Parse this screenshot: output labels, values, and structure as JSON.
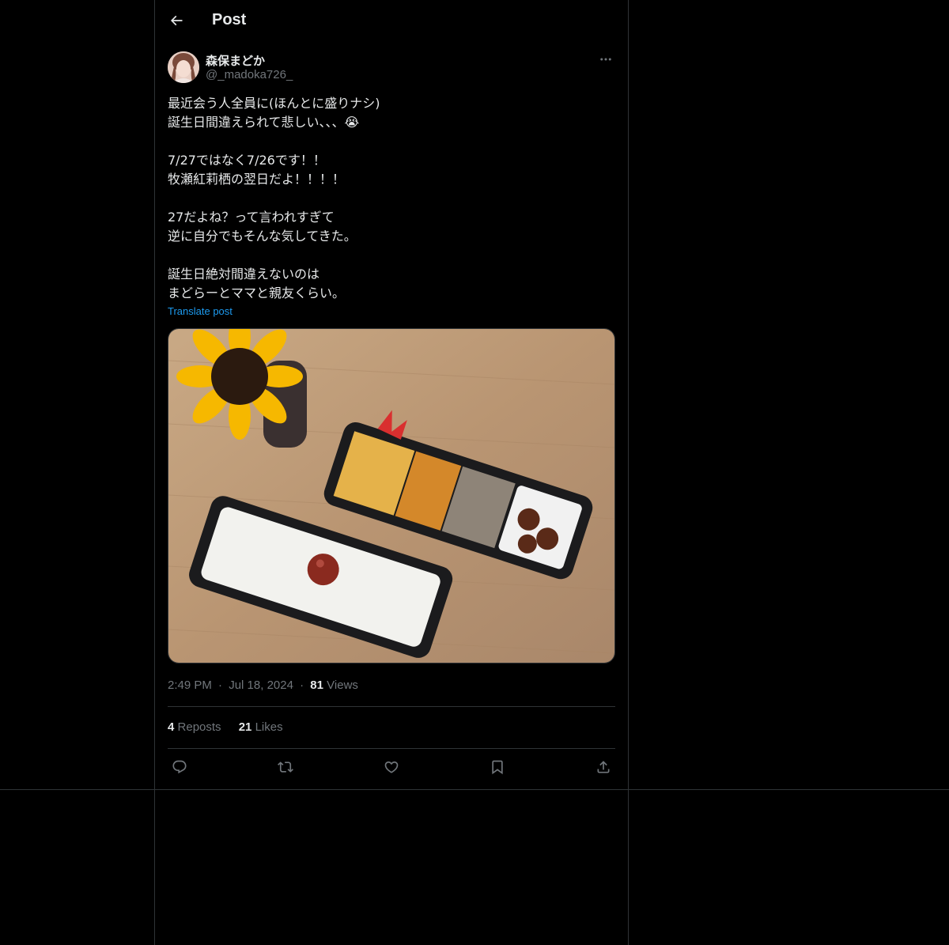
{
  "header": {
    "title": "Post",
    "back_icon": "arrow-left-icon"
  },
  "author": {
    "display_name": "森保まどか",
    "handle": "@_madoka726_"
  },
  "post": {
    "lines": [
      "最近会う人全員に(ほんとに盛りナシ)",
      "誕生日間違えられて悲しい、、、😭",
      "",
      "7/27ではなく7/26です！！",
      "牧瀬紅莉栖の翌日だよ！！！！",
      "",
      "27だよね？って言われすぎて",
      "逆に自分でもそんな気してきた。",
      "",
      "誕生日絶対間違えないのは",
      "まどらーとママと親友くらい。"
    ],
    "translate_label": "Translate post"
  },
  "meta": {
    "time": "2:49 PM",
    "dot1": "·",
    "date": "Jul 18, 2024",
    "dot2": "·",
    "views_count": "81",
    "views_label": "Views"
  },
  "stats": {
    "reposts_count": "4",
    "reposts_label": "Reposts",
    "likes_count": "21",
    "likes_label": "Likes"
  },
  "actions": [
    "reply-icon",
    "repost-icon",
    "like-icon",
    "bookmark-icon",
    "share-icon"
  ],
  "colors": {
    "background": "#000000",
    "text": "#e7e9ea",
    "secondary": "#71767b",
    "link": "#1d9bf0",
    "border": "#2f3336"
  }
}
